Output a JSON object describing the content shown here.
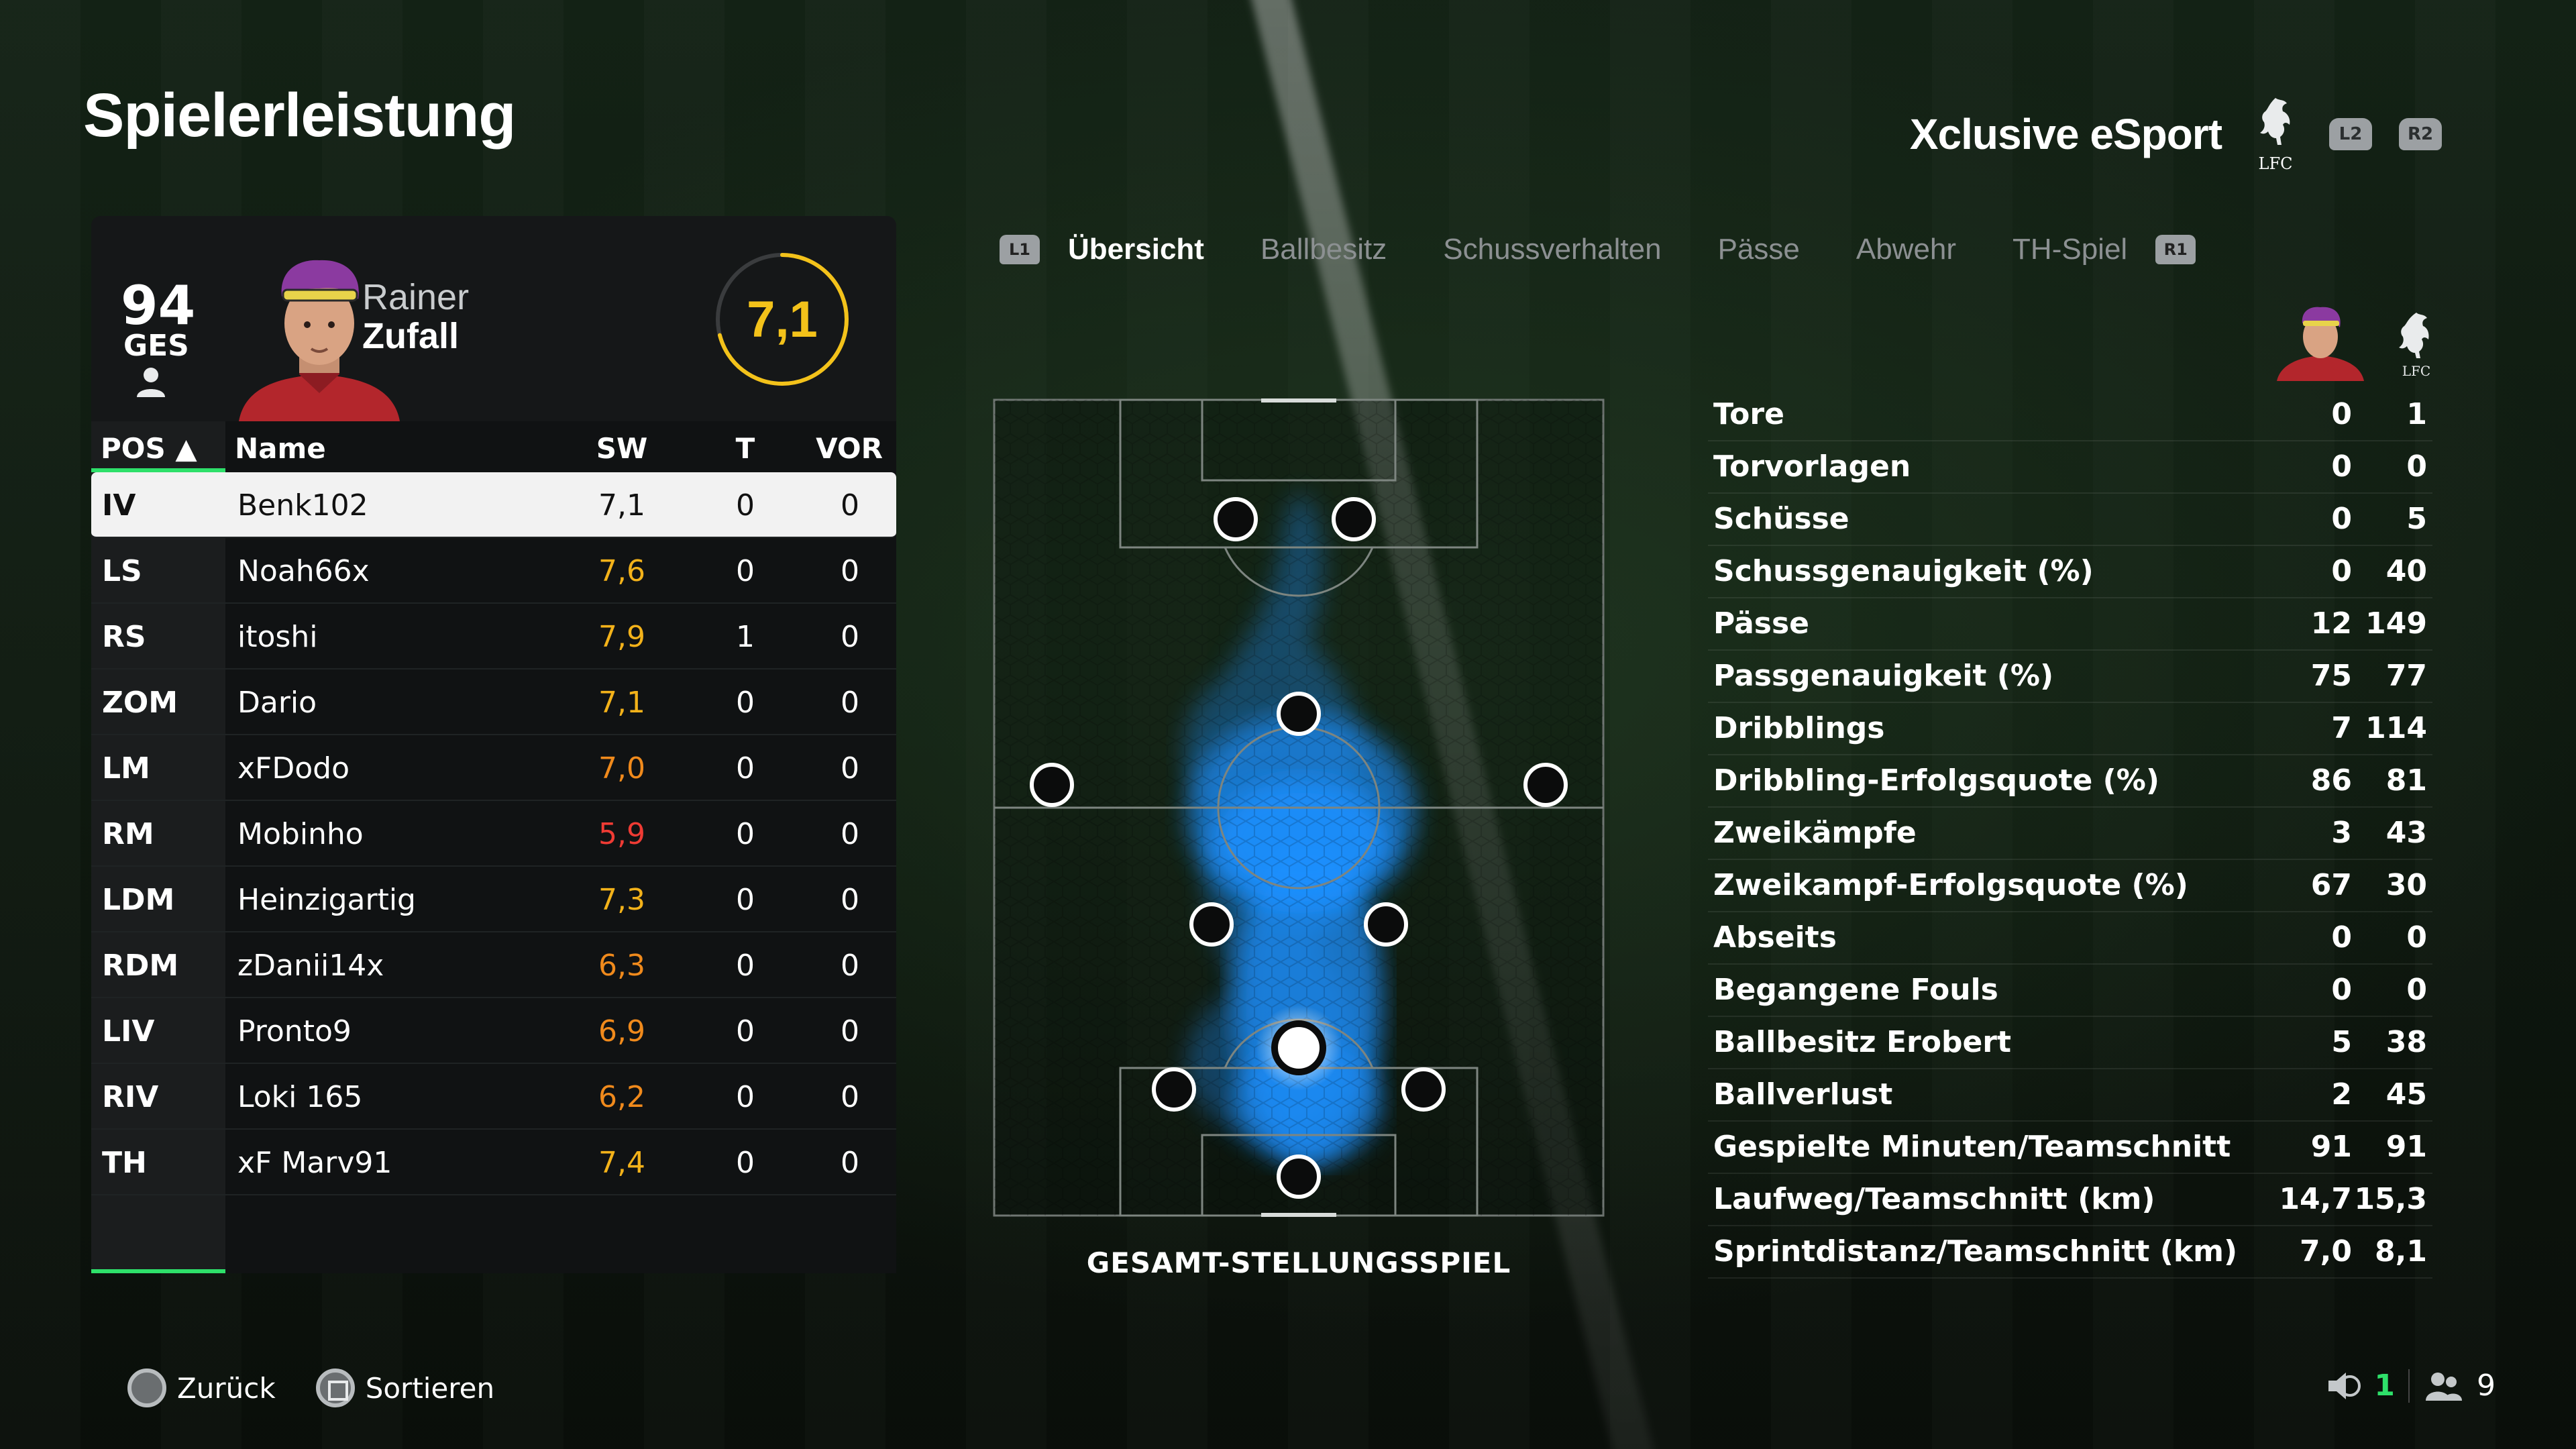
{
  "title": "Spielerleistung",
  "club": {
    "name": "Xclusive eSport",
    "crest_text": "LFC",
    "left_trigger": "L2",
    "right_trigger": "R2"
  },
  "player_card": {
    "overall": "94",
    "overall_label": "GES",
    "first_name": "Rainer",
    "last_name": "Zufall",
    "match_rating": "7,1",
    "match_rating_fraction": 0.71
  },
  "table": {
    "headers": {
      "pos": "POS",
      "sort_arrow": "▲",
      "name": "Name",
      "sw": "SW",
      "t": "T",
      "vor": "VOR"
    },
    "rows": [
      {
        "pos": "IV",
        "name": "Benk102",
        "sw": "7,1",
        "t": "0",
        "vor": "0",
        "sw_color": "#111111",
        "selected": true
      },
      {
        "pos": "LS",
        "name": "Noah66x",
        "sw": "7,6",
        "t": "0",
        "vor": "0",
        "sw_color": "#f3b21a"
      },
      {
        "pos": "RS",
        "name": "itoshi",
        "sw": "7,9",
        "t": "1",
        "vor": "0",
        "sw_color": "#f3b21a"
      },
      {
        "pos": "ZOM",
        "name": "Dario",
        "sw": "7,1",
        "t": "0",
        "vor": "0",
        "sw_color": "#f3b21a"
      },
      {
        "pos": "LM",
        "name": "xFDodo",
        "sw": "7,0",
        "t": "0",
        "vor": "0",
        "sw_color": "#f08a1c"
      },
      {
        "pos": "RM",
        "name": "Mobinho",
        "sw": "5,9",
        "t": "0",
        "vor": "0",
        "sw_color": "#ef3b34"
      },
      {
        "pos": "LDM",
        "name": "Heinzigartig",
        "sw": "7,3",
        "t": "0",
        "vor": "0",
        "sw_color": "#f3b21a"
      },
      {
        "pos": "RDM",
        "name": "zDanii14x",
        "sw": "6,3",
        "t": "0",
        "vor": "0",
        "sw_color": "#f08a1c"
      },
      {
        "pos": "LIV",
        "name": "Pronto9",
        "sw": "6,9",
        "t": "0",
        "vor": "0",
        "sw_color": "#f08a1c"
      },
      {
        "pos": "RIV",
        "name": "Loki 165",
        "sw": "6,2",
        "t": "0",
        "vor": "0",
        "sw_color": "#f08a1c"
      },
      {
        "pos": "TH",
        "name": "xF Marv91",
        "sw": "7,4",
        "t": "0",
        "vor": "0",
        "sw_color": "#f3b21a"
      }
    ]
  },
  "tabs": {
    "left_bumper": "L1",
    "right_bumper": "R1",
    "items": [
      "Übersicht",
      "Ballbesitz",
      "Schussverhalten",
      "Pässe",
      "Abwehr",
      "TH-Spiel"
    ],
    "active_index": 0
  },
  "pitch": {
    "caption": "GESAMT-STELLUNGSSPIEL",
    "heat_color": "#1e90ff"
  },
  "stats": {
    "team_crest_text": "LFC",
    "rows": [
      {
        "label": "Tore",
        "player": "0",
        "team": "1"
      },
      {
        "label": "Torvorlagen",
        "player": "0",
        "team": "0"
      },
      {
        "label": "Schüsse",
        "player": "0",
        "team": "5"
      },
      {
        "label": "Schussgenauigkeit (%)",
        "player": "0",
        "team": "40"
      },
      {
        "label": "Pässe",
        "player": "12",
        "team": "149"
      },
      {
        "label": "Passgenauigkeit (%)",
        "player": "75",
        "team": "77"
      },
      {
        "label": "Dribblings",
        "player": "7",
        "team": "114"
      },
      {
        "label": "Dribbling-Erfolgsquote (%)",
        "player": "86",
        "team": "81"
      },
      {
        "label": "Zweikämpfe",
        "player": "3",
        "team": "43"
      },
      {
        "label": "Zweikampf-Erfolgsquote (%)",
        "player": "67",
        "team": "30"
      },
      {
        "label": "Abseits",
        "player": "0",
        "team": "0"
      },
      {
        "label": "Begangene Fouls",
        "player": "0",
        "team": "0"
      },
      {
        "label": "Ballbesitz Erobert",
        "player": "5",
        "team": "38"
      },
      {
        "label": "Ballverlust",
        "player": "2",
        "team": "45"
      },
      {
        "label": "Gespielte Minuten/Teamschnitt",
        "player": "91",
        "team": "91"
      },
      {
        "label": "Laufweg/Teamschnitt (km)",
        "player": "14,7",
        "team": "15,3"
      },
      {
        "label": "Sprintdistanz/Teamschnitt (km)",
        "player": "7,0",
        "team": "8,1"
      }
    ]
  },
  "footer": {
    "back_label": "Zurück",
    "sort_label": "Sortieren",
    "mic_count": "1",
    "party_count": "9"
  },
  "colors": {
    "accent_green": "#2ee06a",
    "rating_yellow": "#f3c21a",
    "heat_blue": "#1e90ff"
  }
}
